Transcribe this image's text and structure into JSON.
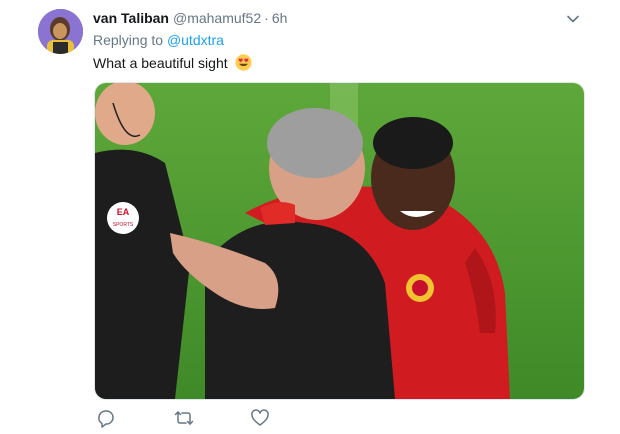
{
  "tweet": {
    "display_name": "van Taliban",
    "handle": "@mahamuf52",
    "separator": "·",
    "time": "6h",
    "replying_prefix": "Replying to",
    "replying_to": "@utdxtra",
    "text": "What a beautiful sight",
    "emoji": "smiling-face-with-heart-eyes"
  },
  "actions": [
    "reply-icon",
    "retweet-icon",
    "like-icon"
  ],
  "colors": {
    "link": "#1da1f2",
    "muted": "#657786",
    "text": "#14171a",
    "pitch": "#4f9a2e",
    "kit_red": "#d01c21"
  }
}
